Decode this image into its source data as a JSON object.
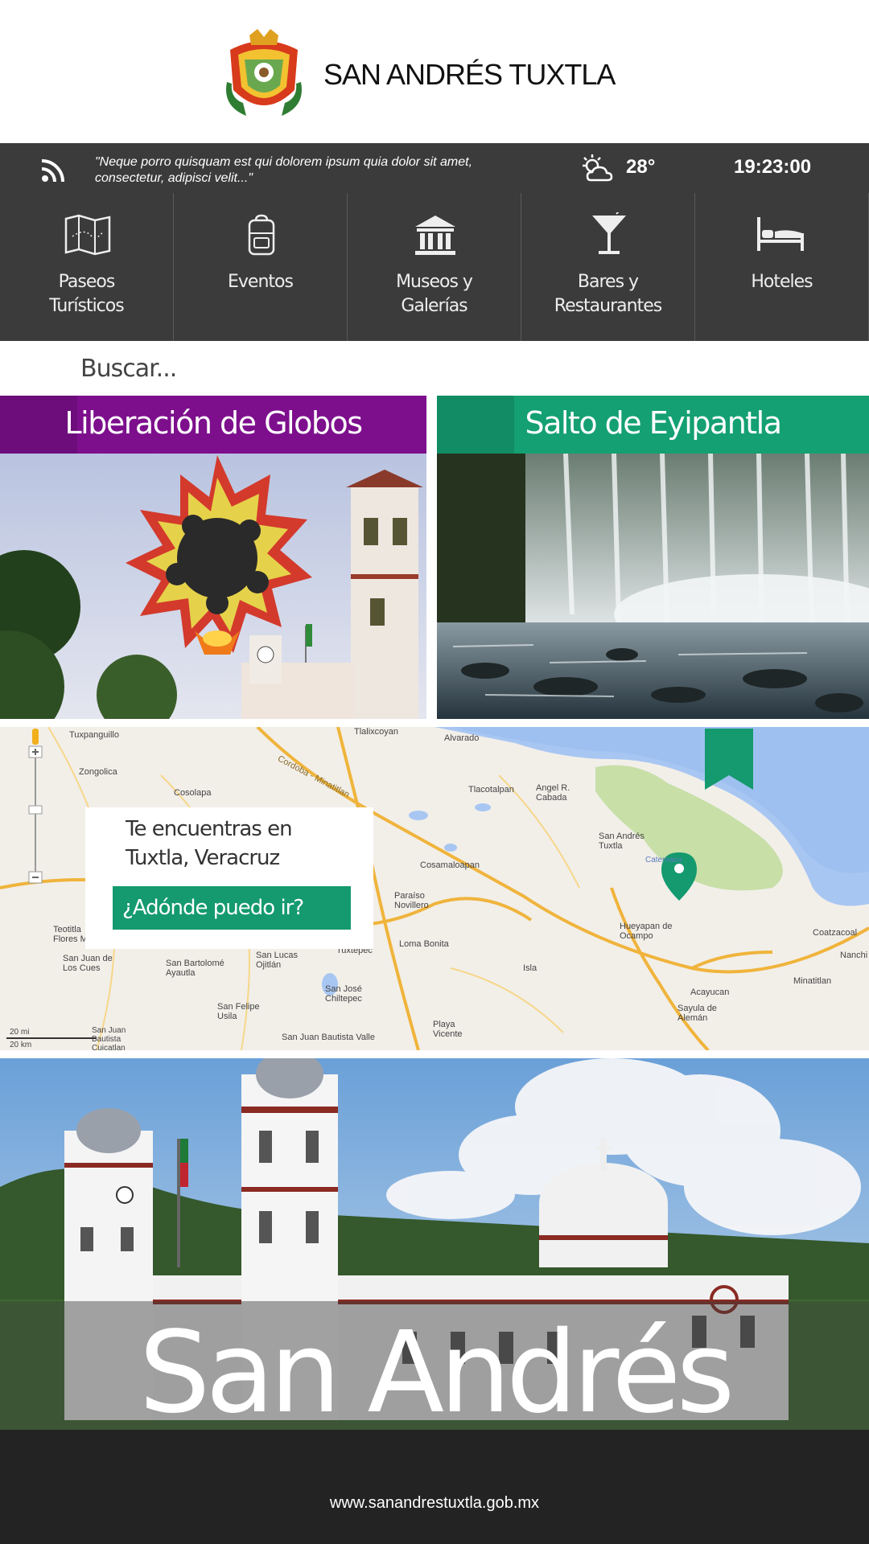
{
  "header": {
    "title": "SAN ANDRÉS TUXTLA",
    "quote": "\"Neque porro quisquam est qui dolorem ipsum quia dolor sit amet, consectetur, adipisci velit...\"",
    "temperature": "28°",
    "time": "19:23:00",
    "icons": [
      "crest-logo",
      "rss-icon",
      "partly-cloudy-icon"
    ]
  },
  "nav": {
    "items": [
      {
        "label1": "Paseos",
        "label2": "Turísticos",
        "icon": "map-icon"
      },
      {
        "label1": "Eventos",
        "label2": "",
        "icon": "backpack-icon"
      },
      {
        "label1": "Museos y",
        "label2": "Galerías",
        "icon": "museum-icon"
      },
      {
        "label1": "Bares y",
        "label2": "Restaurantes",
        "icon": "cocktail-icon"
      },
      {
        "label1": "Hoteles",
        "label2": "",
        "icon": "bed-icon"
      }
    ]
  },
  "search": {
    "placeholder": "Buscar..."
  },
  "cards": [
    {
      "title": "Liberación de Globos",
      "color": "#7d0f8d"
    },
    {
      "title": "Salto de Eyipantla",
      "color": "#14a072"
    }
  ],
  "map": {
    "location_line1": "Te encuentras en",
    "location_line2": "Tuxtla, Veracruz",
    "button": "¿Adónde puedo ir?",
    "accent": "#149a6e",
    "scale_mi": "20 mi",
    "scale_km": "20 km",
    "places": [
      "Tuxpanguillo",
      "Tlalixcoyan",
      "Alvarado",
      "Zongolica",
      "Cosolapa",
      "Tlacotalpan",
      "Angel R. Cabada",
      "San Andrés Tuxtla",
      "Catemaco",
      "Cosamaloapan",
      "Paraíso Novillero",
      "Loma Bonita",
      "Tuxtepec",
      "San Lucas Ojitlán",
      "San José Chiltepec",
      "Isla",
      "Hueyapan de Ocampo",
      "Acayucan",
      "Sayula de Alemán",
      "Minatitlan",
      "Coatzacoal",
      "Nanchi",
      "Teotitla Flores M",
      "San Juan de Los Cues",
      "San Bartolomé Ayautla",
      "San Felipe Usila",
      "San Juan Bautista Valle",
      "San Juan Bautista Cuicatlan",
      "Playa Vicente",
      "Cordoba - Minatitlan"
    ]
  },
  "hero": {
    "title": "San Andrés Tuxtla"
  },
  "footer": {
    "url": "www.sanandrestuxtla.gob.mx"
  }
}
